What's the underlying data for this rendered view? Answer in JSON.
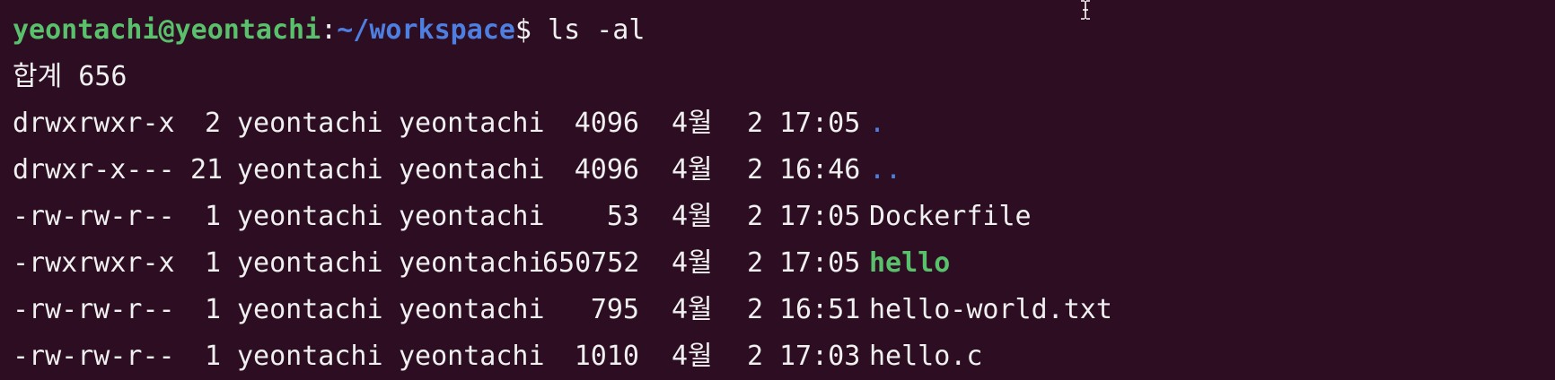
{
  "prompt": {
    "user_host": "yeontachi@yeontachi",
    "separator": ":",
    "path": "~/workspace",
    "symbol": "$",
    "command": " ls -al"
  },
  "total_line": "합계 656",
  "entries": [
    {
      "perm": "drwxrwxr-x",
      "links": "2",
      "owner": "yeontachi",
      "group": "yeontachi",
      "size": "4096",
      "month": "4월",
      "day": "2",
      "time": "17:05",
      "name": "."
    },
    {
      "perm": "drwxr-x---",
      "links": "21",
      "owner": "yeontachi",
      "group": "yeontachi",
      "size": "4096",
      "month": "4월",
      "day": "2",
      "time": "16:46",
      "name": ".."
    },
    {
      "perm": "-rw-rw-r--",
      "links": "1",
      "owner": "yeontachi",
      "group": "yeontachi",
      "size": "53",
      "month": "4월",
      "day": "2",
      "time": "17:05",
      "name": "Dockerfile"
    },
    {
      "perm": "-rwxrwxr-x",
      "links": "1",
      "owner": "yeontachi",
      "group": "yeontachi",
      "size": "650752",
      "month": "4월",
      "day": "2",
      "time": "17:05",
      "name": "hello"
    },
    {
      "perm": "-rw-rw-r--",
      "links": "1",
      "owner": "yeontachi",
      "group": "yeontachi",
      "size": "795",
      "month": "4월",
      "day": "2",
      "time": "16:51",
      "name": "hello-world.txt"
    },
    {
      "perm": "-rw-rw-r--",
      "links": "1",
      "owner": "yeontachi",
      "group": "yeontachi",
      "size": "1010",
      "month": "4월",
      "day": "2",
      "time": "17:03",
      "name": "hello.c"
    }
  ],
  "colors": {
    "background": "#2C0D22",
    "text": "#F0F0F0",
    "user_host": "#59C06B",
    "path": "#4E7FE0",
    "directory": "#4E7FE0",
    "executable": "#59C06B"
  },
  "icons": {
    "mouse_cursor": "text-ibeam-cursor-icon"
  }
}
